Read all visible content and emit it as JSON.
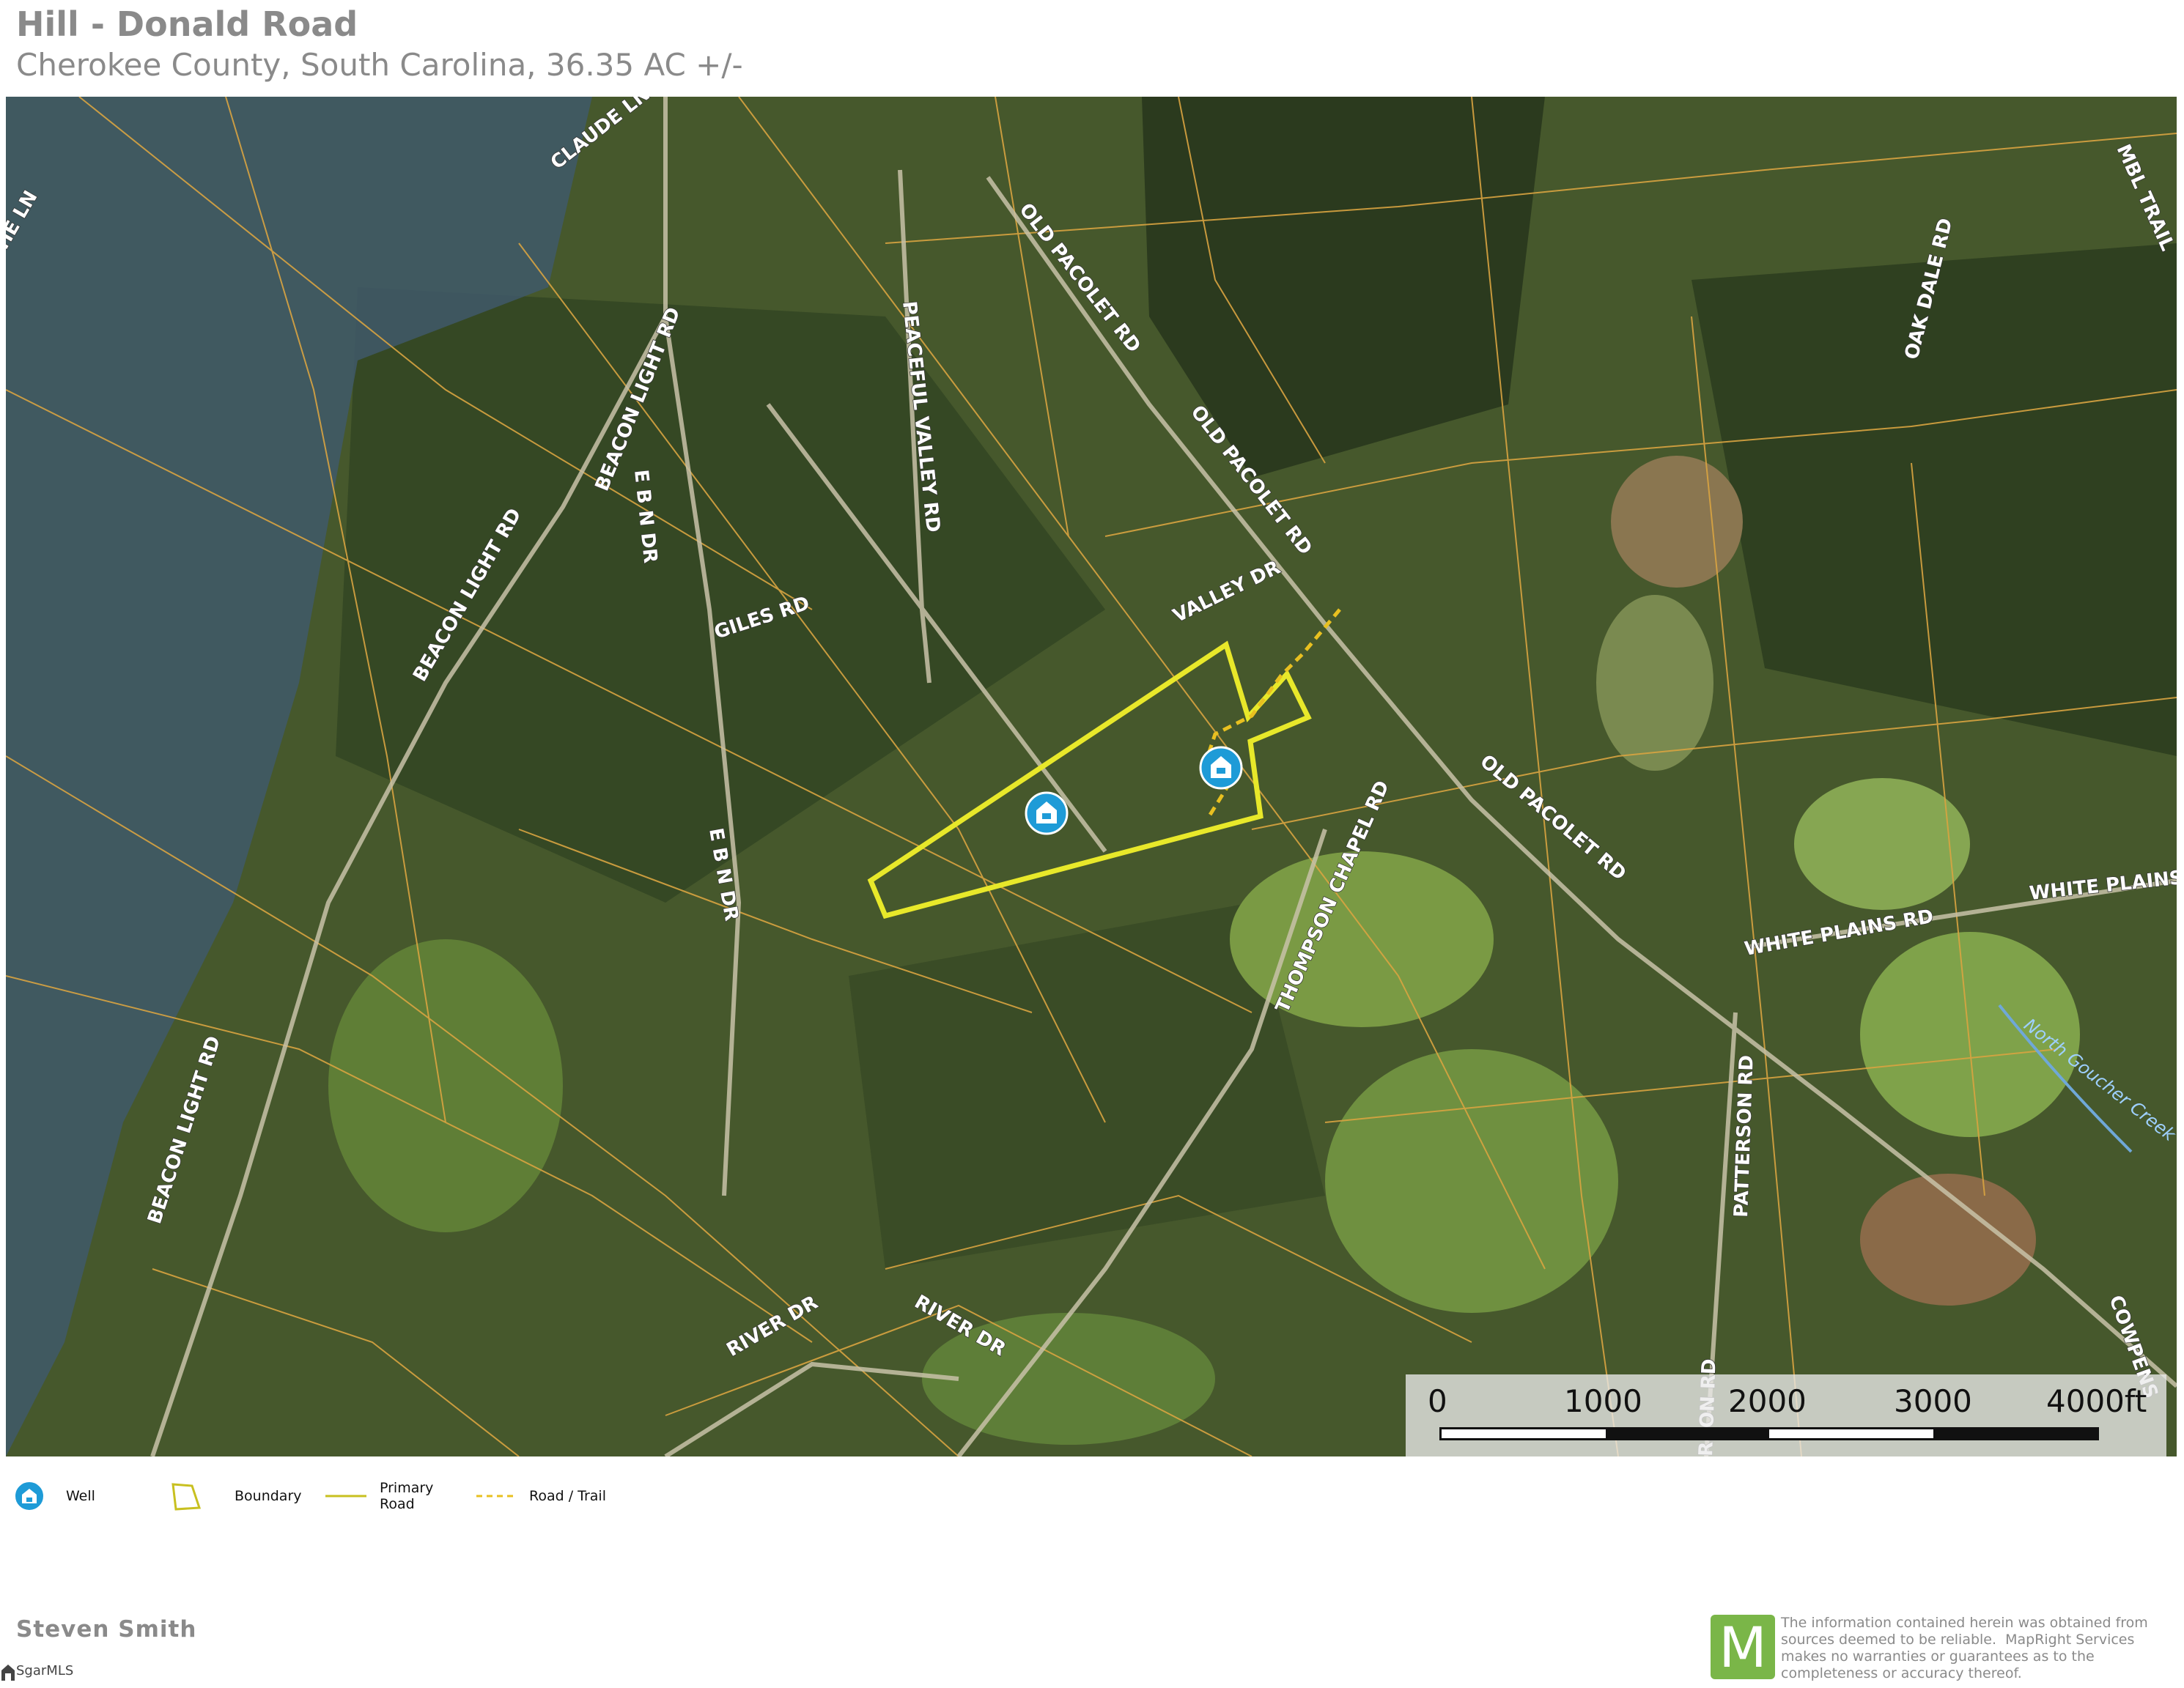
{
  "header": {
    "title": "Hill - Donald Road",
    "subtitle": "Cherokee County, South Carolina, 36.35 AC +/-"
  },
  "map": {
    "road_labels": [
      "CLAUDE LN",
      "OLD PACOLET RD",
      "OLD PACOLET RD",
      "OLD PACOLET RD",
      "PEACEFUL VALLEY RD",
      "BEACON LIGHT RD",
      "BEACON LIGHT RD",
      "BEACON LIGHT RD",
      "E B N DR",
      "E B N DR",
      "GILES RD",
      "VALLEY DR",
      "THOMPSON CHAPEL RD",
      "WHITE PLAINS RD",
      "WHITE PLAINS R",
      "PATTERSON RD",
      "RIVER DR",
      "RIVER DR",
      "OAK DALE RD",
      "COWPENS",
      "MBL TRAIL",
      "HE LN",
      "RSON RD"
    ],
    "creek_label": "North Goucher Creek",
    "colors": {
      "boundary": "#e8e82a",
      "parcel_lines": "#d9a441",
      "well_marker": "#1e9bd7",
      "road_trail": "#e8c020"
    },
    "icons": [
      "well-icon",
      "well-icon"
    ]
  },
  "scale": {
    "ticks": [
      "0",
      "1000",
      "2000",
      "3000",
      "4000ft"
    ]
  },
  "legend": {
    "items": [
      {
        "icon": "well-icon",
        "label": "Well"
      },
      {
        "icon": "boundary-icon",
        "label": "Boundary"
      },
      {
        "icon": "primary-road-icon",
        "label": "Primary Road"
      },
      {
        "icon": "road-trail-icon",
        "label": "Road / Trail"
      }
    ]
  },
  "footer": {
    "agent": "Steven  Smith",
    "mls": "SgarMLS",
    "logo_letter": "M",
    "disclaimer": "The information contained herein was obtained from sources deemed to be reliable.  MapRight Services makes no warranties or guarantees as to the completeness or accuracy thereof."
  }
}
